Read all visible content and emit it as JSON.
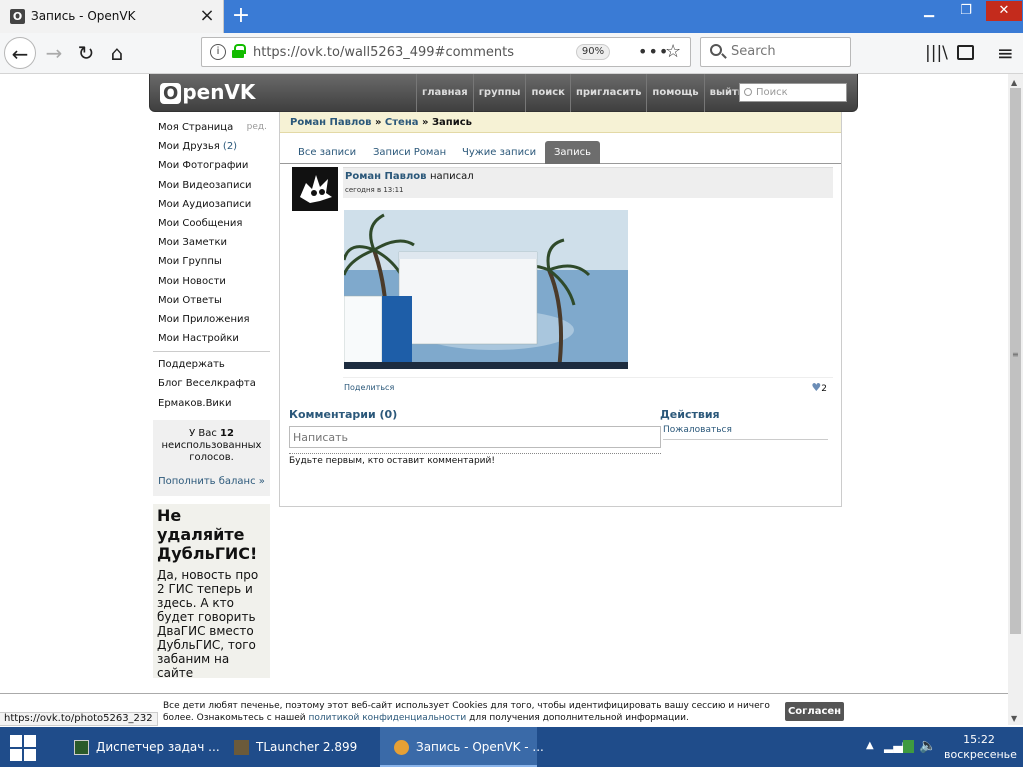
{
  "browser": {
    "tab_title": "Запись - OpenVK",
    "tab_icon": "O",
    "url": "https://ovk.to/wall5263_499#comments",
    "zoom": "90%",
    "search_placeholder": "Search"
  },
  "header": {
    "logo_letter": "O",
    "logo_text": "penVK",
    "menu": [
      "главная",
      "группы",
      "поиск",
      "пригласить",
      "помощь",
      "выйти"
    ],
    "search_placeholder": "Поиск"
  },
  "sidebar": {
    "edit": "ред.",
    "items": [
      {
        "label": "Моя Страница"
      },
      {
        "label": "Мои Друзья",
        "count": "(2)"
      },
      {
        "label": "Мои Фотографии"
      },
      {
        "label": "Мои Видеозаписи"
      },
      {
        "label": "Мои Аудиозаписи"
      },
      {
        "label": "Мои Сообщения"
      },
      {
        "label": "Мои Заметки"
      },
      {
        "label": "Мои Группы"
      },
      {
        "label": "Мои Новости"
      },
      {
        "label": "Мои Ответы"
      },
      {
        "label": "Мои Приложения"
      },
      {
        "label": "Мои Настройки"
      }
    ],
    "extra": [
      {
        "label": "Поддержать"
      },
      {
        "label": "Блог Веселкрафта"
      },
      {
        "label": "Ермаков.Вики"
      }
    ],
    "votes_pre": "У Вас",
    "votes_count": "12",
    "votes_post": "неиспользованных голосов.",
    "replenish": "Пополнить баланс »",
    "ad_title": "Не удаляйте ДубльГИС!",
    "ad_text": "Да, новость про 2 ГИС теперь и здесь. А кто будет говорить ДваГИС вместо ДубльГИС, того забаним на сайте"
  },
  "breadcrumb": {
    "author": "Роман Павлов",
    "sep1": " » ",
    "wall": "Стена",
    "sep2": " » ",
    "current": "Запись"
  },
  "tabs": [
    "Все записи",
    "Записи Роман",
    "Чужие записи",
    "Запись"
  ],
  "post": {
    "author": "Роман Павлов",
    "action": "написал",
    "time": "сегодня в 13:11",
    "share": "Поделиться",
    "likes": "2"
  },
  "comments": {
    "title": "Комментарии (0)",
    "placeholder": "Написать",
    "empty": "Будьте первым, кто оставит комментарий!"
  },
  "actions": {
    "title": "Действия",
    "report": "Пожаловаться"
  },
  "cookie": {
    "text1": "Все дети любят печенье, поэтому этот веб-сайт использует Cookies для того, чтобы идентифицировать вашу сессию и ничего более. Ознакомьтесь с нашей ",
    "link": "политикой конфиденциальности",
    "text2": " для получения дополнительной информации.",
    "accept": "Согласен"
  },
  "status_url": "https://ovk.to/photo5263_232",
  "taskbar": {
    "items": [
      "Диспетчер задач ...",
      "TLauncher 2.899",
      "Запись - OpenVK - ..."
    ],
    "time": "15:22",
    "day": "воскресенье"
  },
  "colors": {
    "link": "#2b587a",
    "titlebar": "#3a7bd5",
    "taskbar": "#1f4c8a",
    "crumb_bg": "#f6f2d5"
  }
}
